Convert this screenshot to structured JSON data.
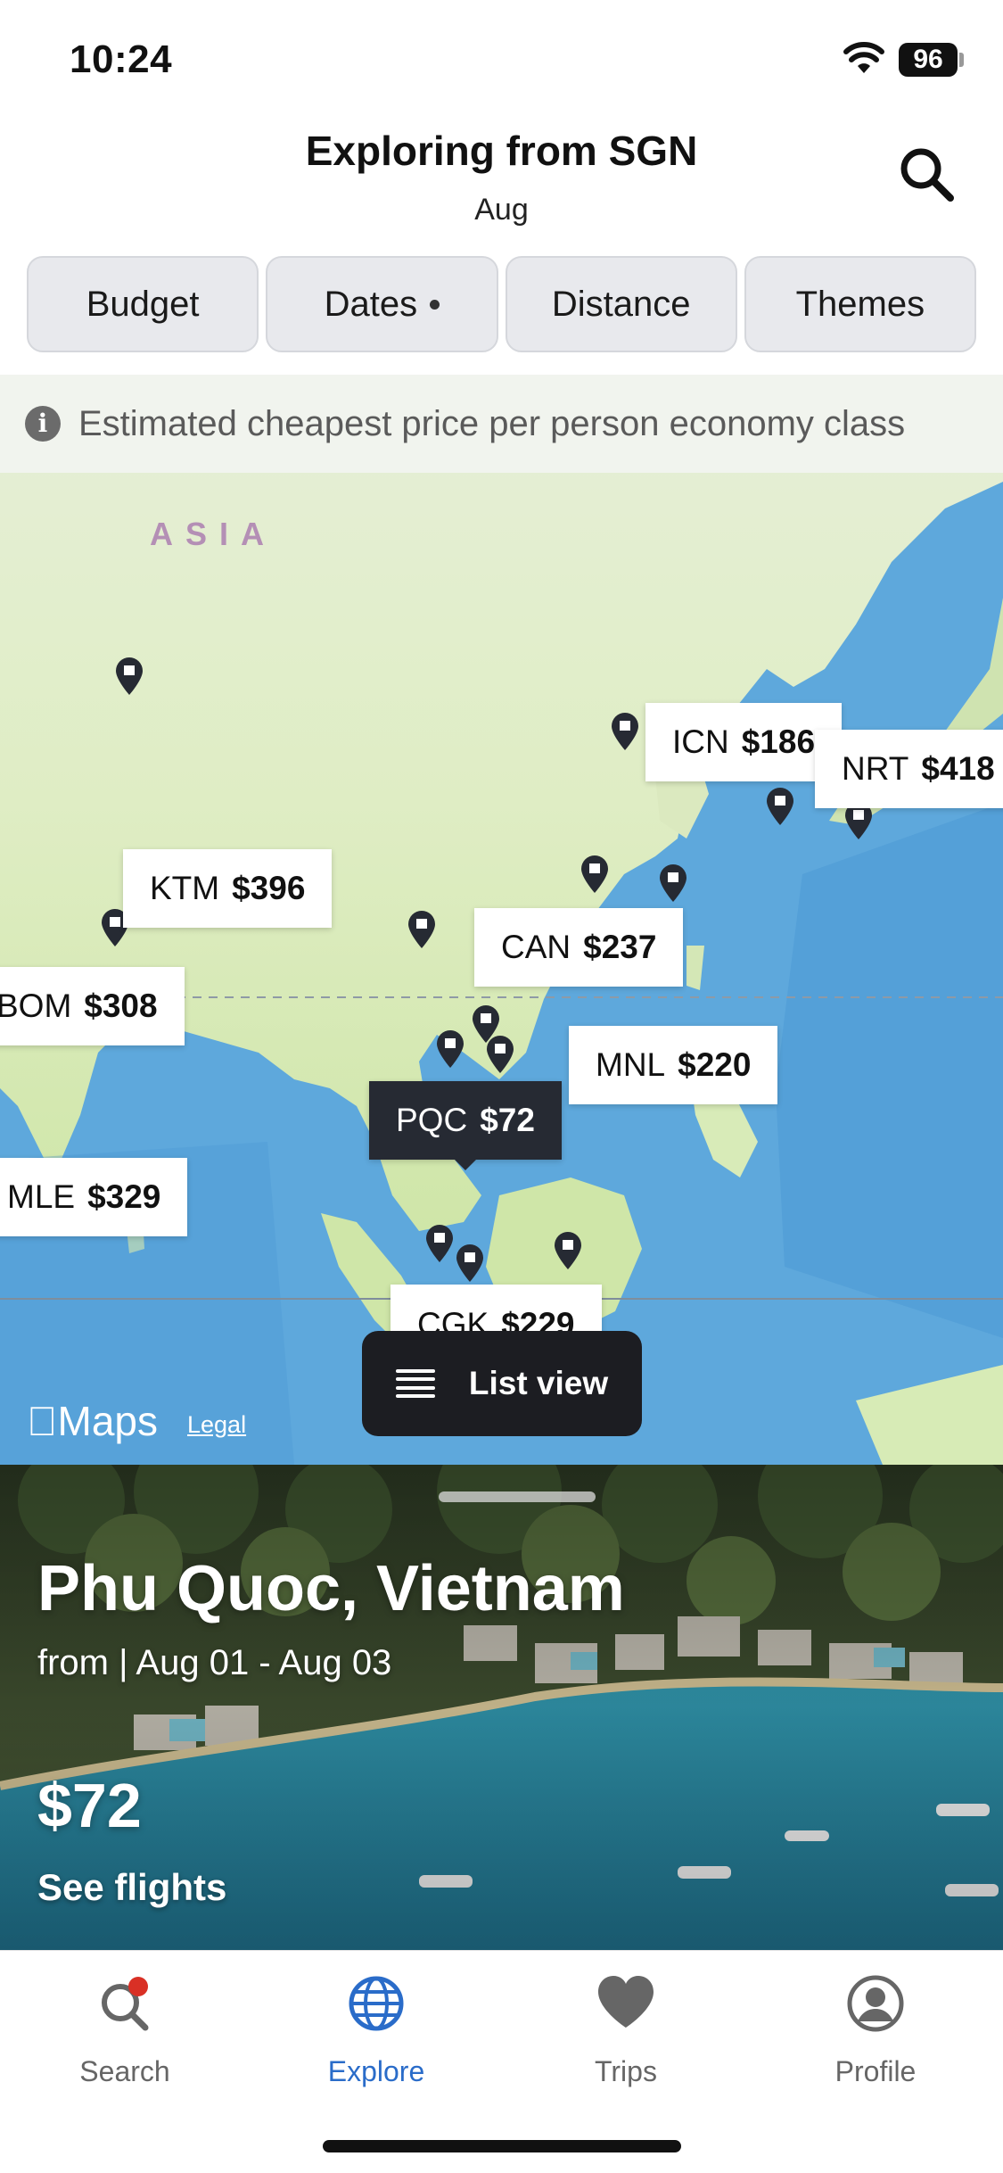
{
  "status": {
    "time": "10:24",
    "battery": "96"
  },
  "header": {
    "title": "Exploring from SGN",
    "subtitle": "Aug"
  },
  "filters": [
    {
      "label": "Budget",
      "dot": false
    },
    {
      "label": "Dates",
      "dot": true
    },
    {
      "label": "Distance",
      "dot": false
    },
    {
      "label": "Themes",
      "dot": false
    }
  ],
  "map": {
    "info_text": "Estimated cheapest price per person economy class",
    "region_label": "ASIA",
    "maps_brand": "Maps",
    "legal": "Legal",
    "list_view_label": "List view",
    "destinations": [
      {
        "code": "ICN",
        "price": "$186"
      },
      {
        "code": "NRT",
        "price": "$418"
      },
      {
        "code": "KTM",
        "price": "$396"
      },
      {
        "code": "CAN",
        "price": "$237"
      },
      {
        "code": "BOM",
        "price": "$308"
      },
      {
        "code": "MNL",
        "price": "$220"
      },
      {
        "code": "PQC",
        "price": "$72",
        "selected": true
      },
      {
        "code": "MLE",
        "price": "$329"
      },
      {
        "code": "CGK",
        "price": "$229"
      }
    ]
  },
  "card": {
    "destination": "Phu Quoc, Vietnam",
    "dates_text": "from  | Aug 01 - Aug 03",
    "price": "$72",
    "cta": "See flights"
  },
  "tabs": [
    {
      "label": "Search",
      "icon": "search-icon",
      "badge": true
    },
    {
      "label": "Explore",
      "icon": "globe-icon",
      "active": true
    },
    {
      "label": "Trips",
      "icon": "heart-icon"
    },
    {
      "label": "Profile",
      "icon": "profile-icon"
    }
  ],
  "colors": {
    "accent": "#2a6cc9",
    "selected_tag": "#262a33",
    "badge": "#d93025"
  }
}
